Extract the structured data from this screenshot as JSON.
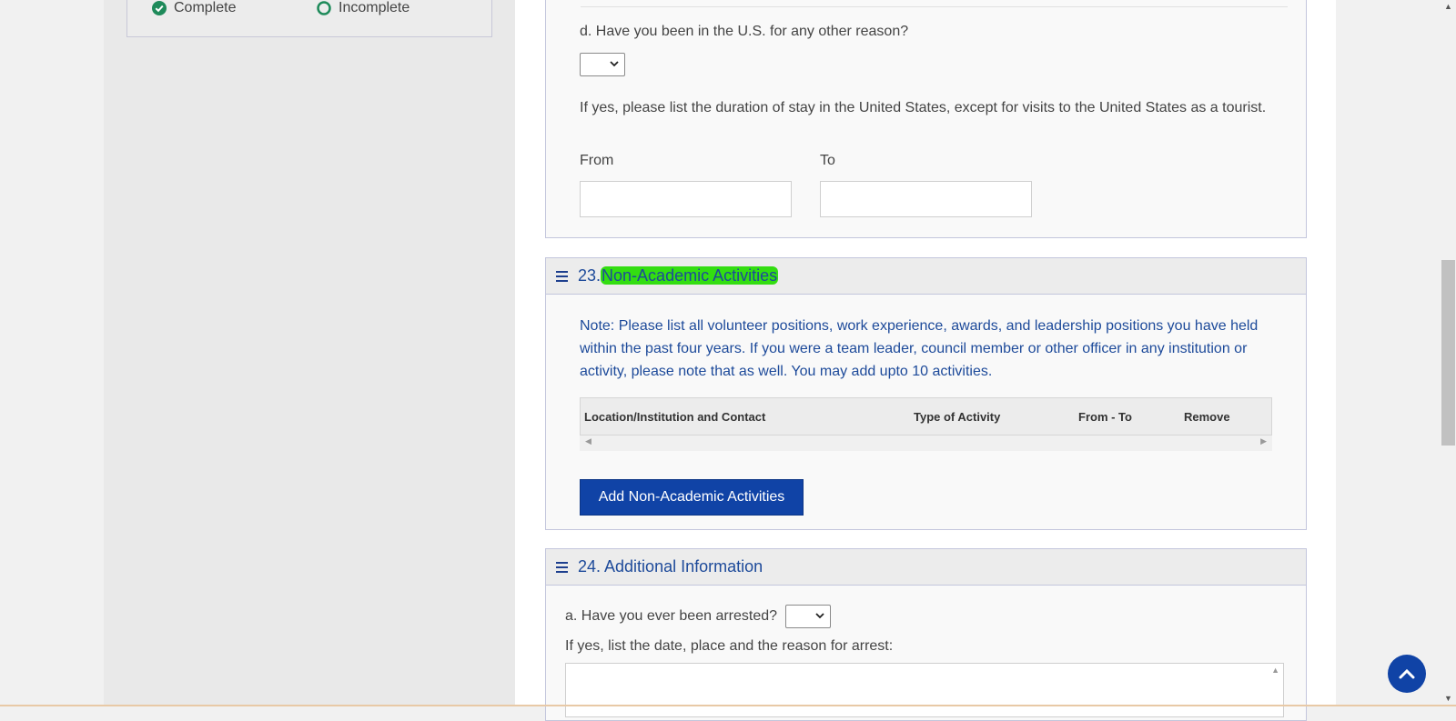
{
  "legend": {
    "complete_label": "Complete",
    "incomplete_label": "Incomplete",
    "complete_icon": "check-circle-icon",
    "incomplete_icon": "empty-circle-icon",
    "color": "#1e8a5a"
  },
  "section_prev": {
    "question_d": "d. Have you been in the U.S. for any other reason?",
    "question_d_value": "",
    "duration_note": "If yes, please list the duration of stay in the United States, except for visits to the United States as a tourist.",
    "from_label": "From",
    "to_label": "To",
    "from_value": "",
    "to_value": ""
  },
  "section_23": {
    "number": "23.",
    "title": "Non-Academic Activities",
    "highlight_color": "#33dd11",
    "note": "Note: Please list all volunteer positions, work experience, awards, and leadership positions you have held within the past four years. If you were a team leader, council member or other officer in any institution or activity, please note that as well. You may add upto 10 activities.",
    "columns": [
      "Location/Institution and Contact",
      "Type of Activity",
      "From - To",
      "Remove"
    ],
    "add_button": "Add Non-Academic Activities"
  },
  "section_24": {
    "title": "24. Additional Information",
    "question_a": "a. Have you ever been arrested?",
    "question_a_value": "",
    "arrest_note": "If yes, list the date, place and the reason for arrest:",
    "arrest_value": ""
  },
  "colors": {
    "accent": "#1043a6",
    "heading_text": "#1d4a9a"
  },
  "icons": {
    "menu": "hamburger-icon",
    "back_to_top": "chevron-up-icon",
    "dropdown": "chevron-down-icon"
  }
}
